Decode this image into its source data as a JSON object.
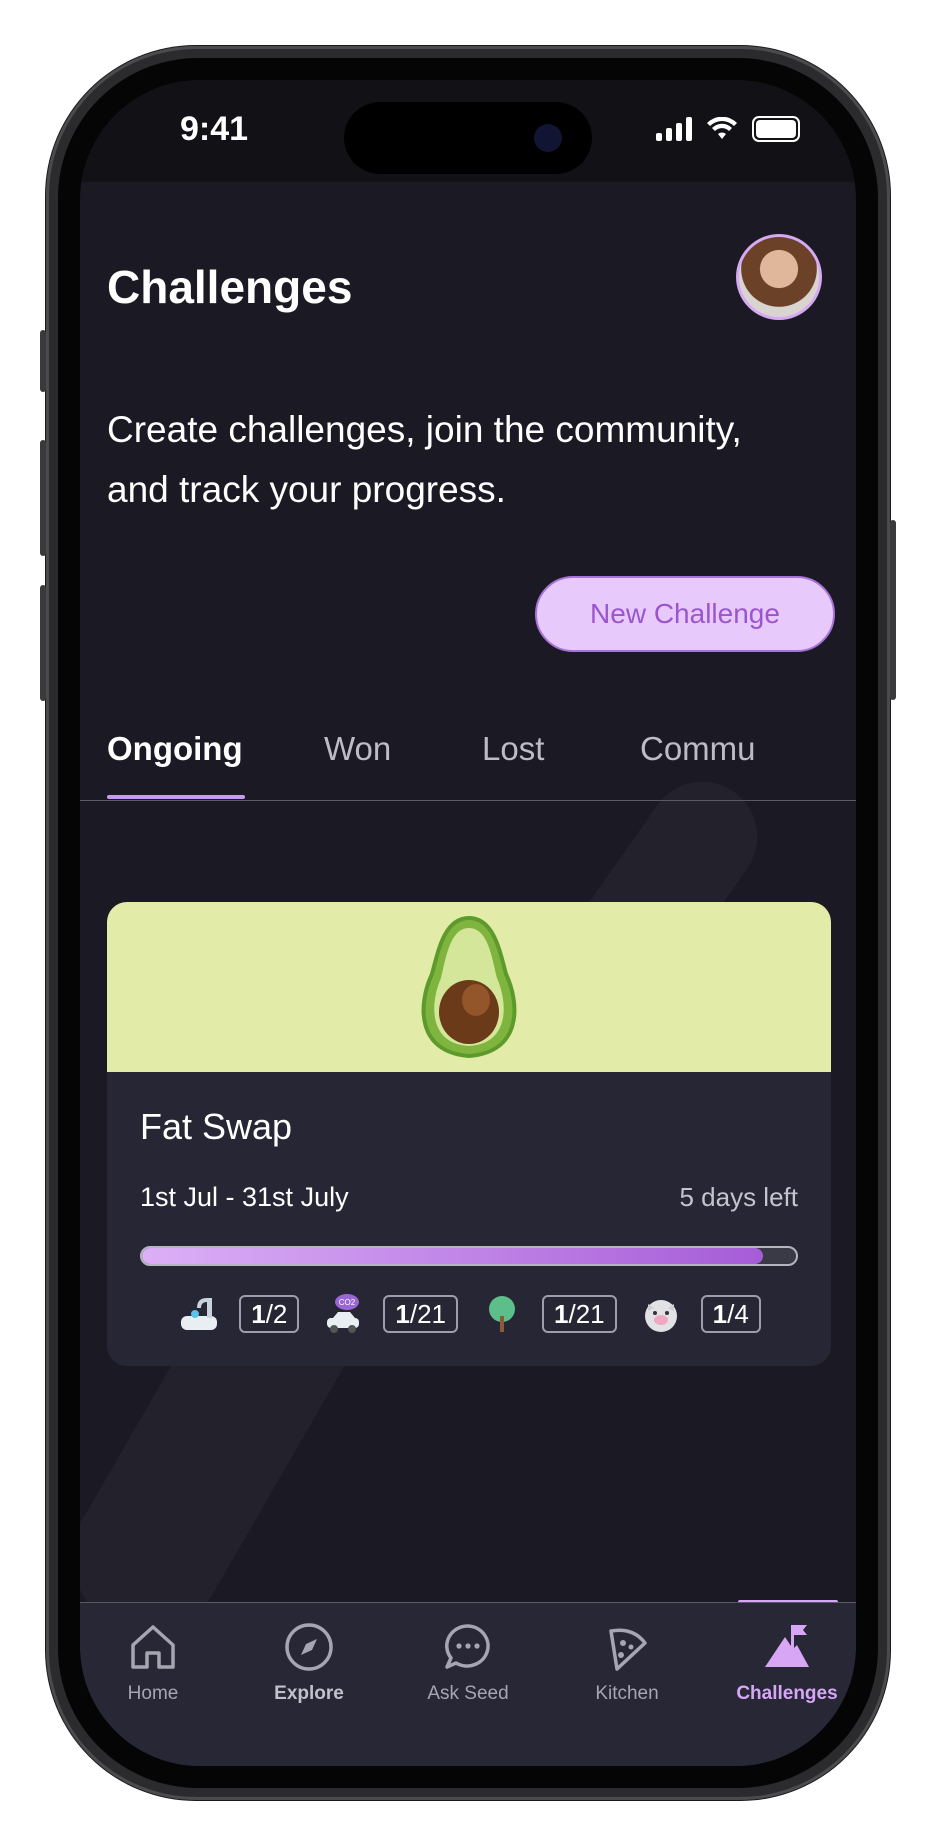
{
  "status_bar": {
    "time": "9:41"
  },
  "header": {
    "title": "Challenges",
    "avatar": "user-avatar"
  },
  "intro": {
    "text": "Create challenges, join the community, and track your progress."
  },
  "new_challenge_label": "New Challenge",
  "tabs": [
    {
      "label": "Ongoing",
      "active": true
    },
    {
      "label": "Won",
      "active": false
    },
    {
      "label": "Lost",
      "active": false
    },
    {
      "label": "Commu",
      "active": false
    }
  ],
  "challenge_card": {
    "hero_icon": "avocado-icon",
    "title": "Fat Swap",
    "dates": "1st Jul - 31st July",
    "days_left": "5 days left",
    "progress": 0.95,
    "stats": [
      {
        "icon": "bath-icon",
        "done": "1",
        "total": "/2"
      },
      {
        "icon": "car-co2-icon",
        "done": "1",
        "total": "/21"
      },
      {
        "icon": "tree-icon",
        "done": "1",
        "total": "/21"
      },
      {
        "icon": "pig-icon",
        "done": "1",
        "total": "/4"
      }
    ]
  },
  "bottom_nav": [
    {
      "label": "Home",
      "icon": "home-icon"
    },
    {
      "label": "Explore",
      "icon": "compass-icon"
    },
    {
      "label": "Ask Seed",
      "icon": "chat-icon"
    },
    {
      "label": "Kitchen",
      "icon": "pizza-icon"
    },
    {
      "label": "Challenges",
      "icon": "flag-mountain-icon",
      "active": true
    }
  ],
  "colors": {
    "accent": "#d7a7f6",
    "background": "#1b1a24",
    "card": "#262635",
    "hero": "#e3eba9"
  }
}
